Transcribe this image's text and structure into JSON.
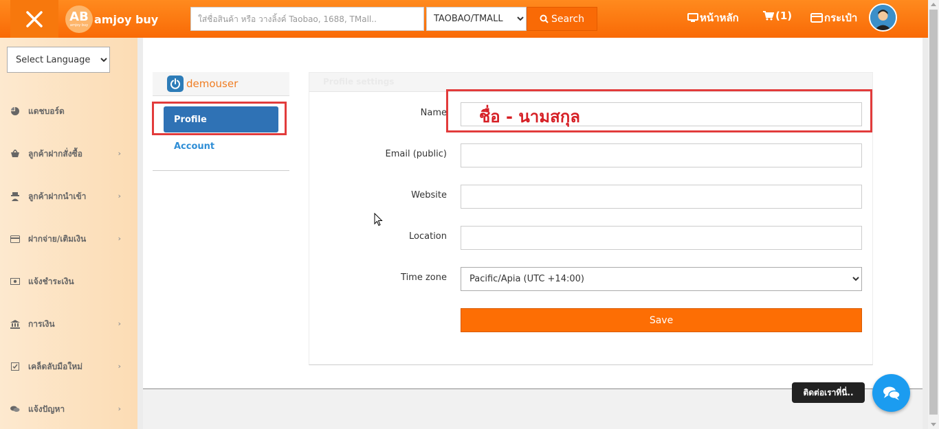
{
  "colors": {
    "brand_orange": "#f96a06",
    "sidebar_bg": "#fde9cf",
    "primary_blue": "#2f72b5",
    "highlight_red": "#e23b3b",
    "save_orange": "#fd6e04",
    "chat_blue": "#1b9cf0"
  },
  "header": {
    "logo_badge": "AB",
    "logo_badge_sub": "amjoy buy",
    "logo_text": "amjoy buy",
    "search_placeholder": "ใส่ชื่อสินค้า หรือ วางลิ้งค์ Taobao, 1688, TMall..",
    "platform_selected": "TAOBAO/TMALL",
    "search_label": "Search",
    "nav_home": "หน้าหลัก",
    "nav_cart": "(1)",
    "nav_wallet": "กระเป๋า"
  },
  "sidebar": {
    "language_selected": "Select Language",
    "items": [
      {
        "label": "แดชบอร์ด",
        "icon": "pie-chart-icon"
      },
      {
        "label": "ลูกค้าฝากสั่งซื้อ",
        "icon": "basket-icon"
      },
      {
        "label": "ลูกค้าฝากนำเข้า",
        "icon": "user-secret-icon"
      },
      {
        "label": "ฝากจ่าย/เติมเงิน",
        "icon": "credit-card-icon"
      },
      {
        "label": "แจ้งชำระเงิน",
        "icon": "money-icon"
      },
      {
        "label": "การเงิน",
        "icon": "bank-icon"
      },
      {
        "label": "เคล็ดลับมือใหม่",
        "icon": "check-square-icon"
      },
      {
        "label": "แจ้งปัญหา",
        "icon": "comments-icon"
      }
    ]
  },
  "user_panel": {
    "username": "demouser",
    "profile_label": "Profile",
    "account_label": "Account"
  },
  "settings": {
    "header": "Profile settings",
    "name_label": "Name",
    "name_overlay": "ชื่อ - นามสกุล",
    "email_label": "Email (public)",
    "website_label": "Website",
    "location_label": "Location",
    "timezone_label": "Time zone",
    "timezone_selected": "Pacific/Apia (UTC +14:00)",
    "save_label": "Save"
  },
  "contact": {
    "label": "ติดต่อเราที่นี่.."
  }
}
